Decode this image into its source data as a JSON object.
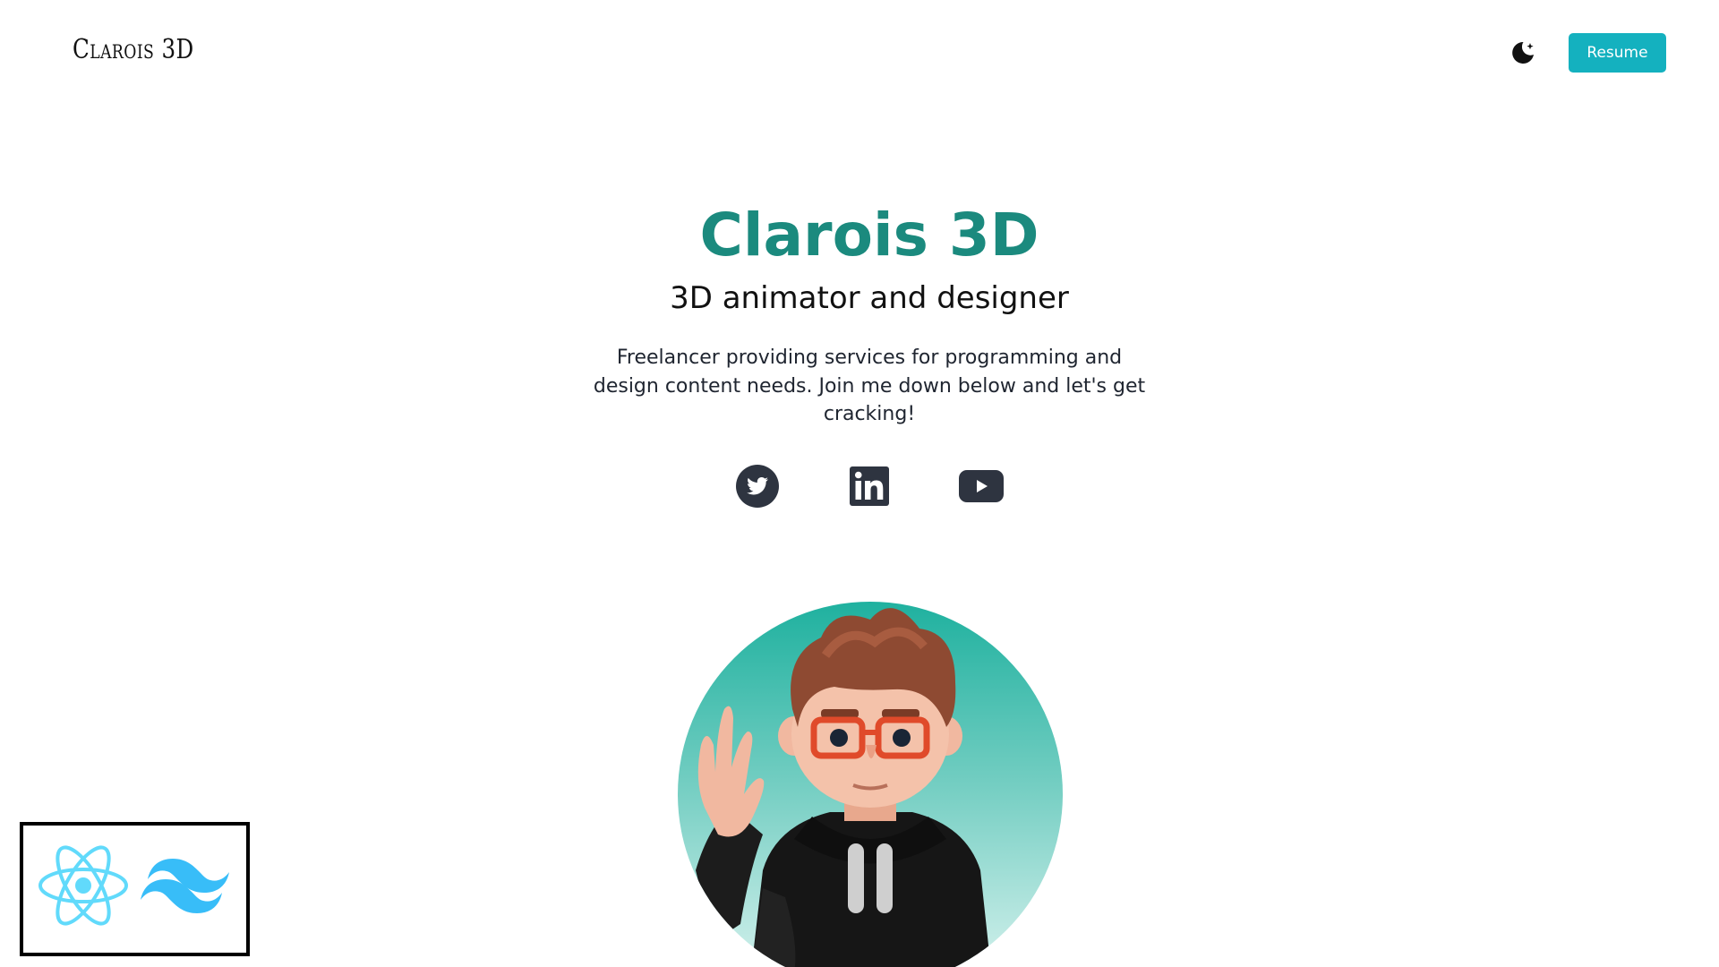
{
  "navbar": {
    "brand": "Clarois 3D",
    "theme_toggle_icon": "moon-icon",
    "resume_label": "Resume",
    "accent_color": "#14b1bf"
  },
  "hero": {
    "title": "Clarois 3D",
    "subtitle": "3D animator and designer",
    "description": "Freelancer providing services for programming and design content needs. Join me down below and let's get cracking!",
    "title_color": "#1b8a7e"
  },
  "socials": [
    {
      "icon": "twitter-icon"
    },
    {
      "icon": "linkedin-icon"
    },
    {
      "icon": "youtube-icon"
    }
  ],
  "avatar": {
    "icon": "avatar-3d-character"
  },
  "tech_badges": [
    {
      "icon": "react-icon",
      "color": "#61dafb"
    },
    {
      "icon": "tailwind-icon",
      "color": "#38bdf8"
    }
  ]
}
